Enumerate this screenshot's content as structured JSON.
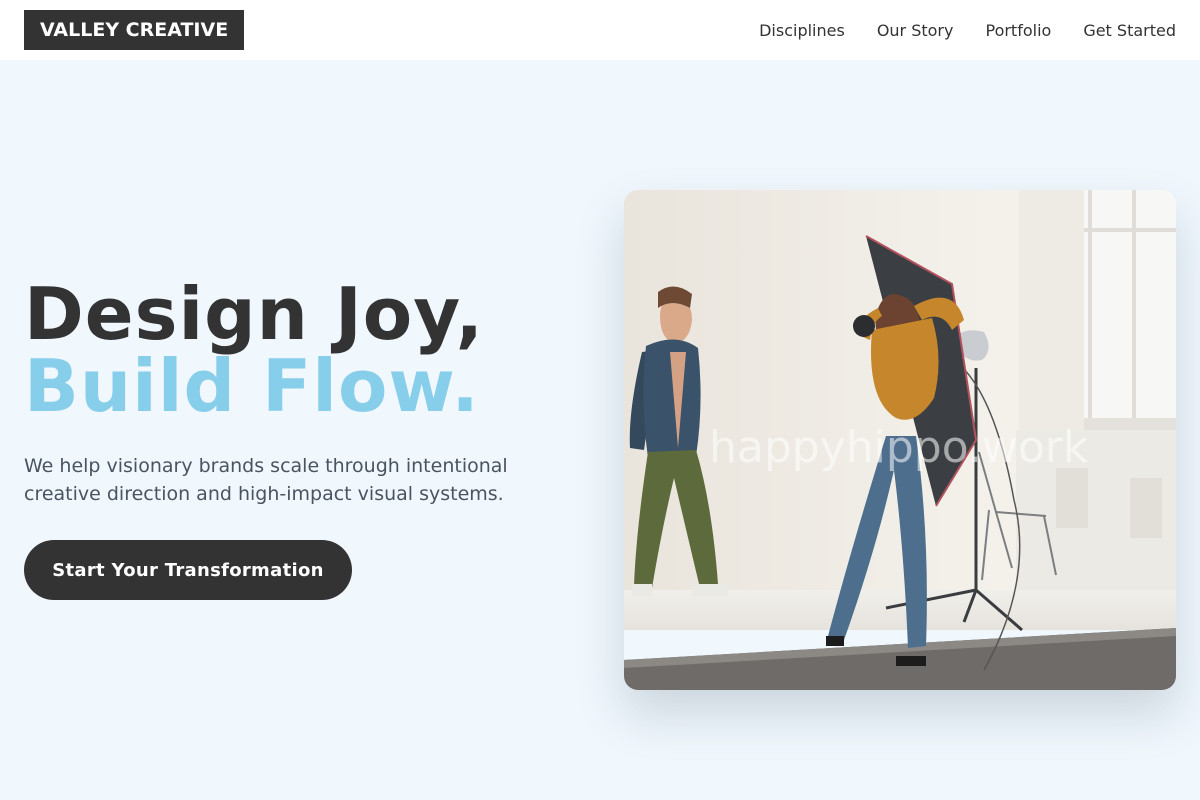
{
  "brand": {
    "logo_text": "VALLEY CREATIVE"
  },
  "nav": {
    "items": [
      {
        "label": "Disciplines"
      },
      {
        "label": "Our Story"
      },
      {
        "label": "Portfolio"
      },
      {
        "label": "Get Started"
      }
    ]
  },
  "hero": {
    "headline_line1": "Design Joy,",
    "headline_line2": "Build Flow.",
    "subtitle": "We help visionary brands scale through intentional creative direction and high-impact visual systems.",
    "cta_label": "Start Your Transformation",
    "image_watermark": "happyhippo.work"
  },
  "colors": {
    "page_bg": "#f0f7fd",
    "dark": "#333333",
    "accent": "#87ceeb"
  }
}
